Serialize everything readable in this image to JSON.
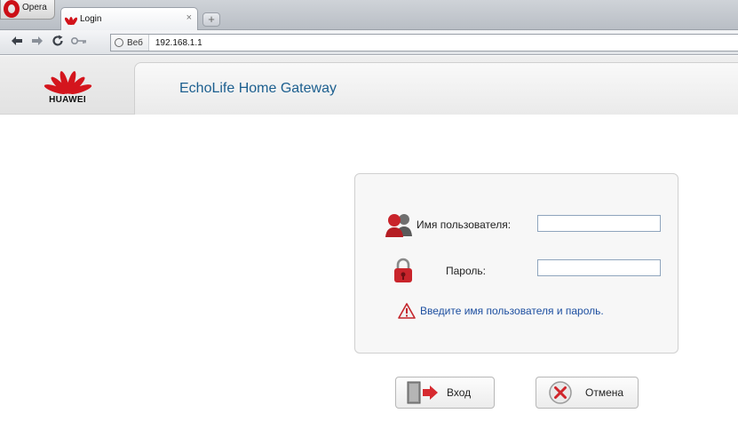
{
  "browser": {
    "menu_label": "Opera",
    "tab": {
      "title": "Login",
      "close_glyph": "×"
    },
    "new_tab_glyph": "+",
    "nav": {
      "back_icon": "back-arrow-icon",
      "forward_icon": "forward-arrow-icon",
      "reload_icon": "reload-icon",
      "key_icon": "key-icon"
    },
    "address": {
      "badge": "Веб",
      "url": "192.168.1.1"
    }
  },
  "header": {
    "brand": "HUAWEI",
    "product_title": "EchoLife Home Gateway"
  },
  "login": {
    "username_label": "Имя пользователя:",
    "username_value": "",
    "password_label": "Пароль:",
    "password_value": "",
    "warning": "Введите имя пользователя и пароль."
  },
  "buttons": {
    "login_label": "Вход",
    "cancel_label": "Отмена"
  },
  "colors": {
    "brand_red": "#d4151d",
    "title_blue": "#1c5f8f",
    "warning_blue": "#1d4fa0"
  }
}
